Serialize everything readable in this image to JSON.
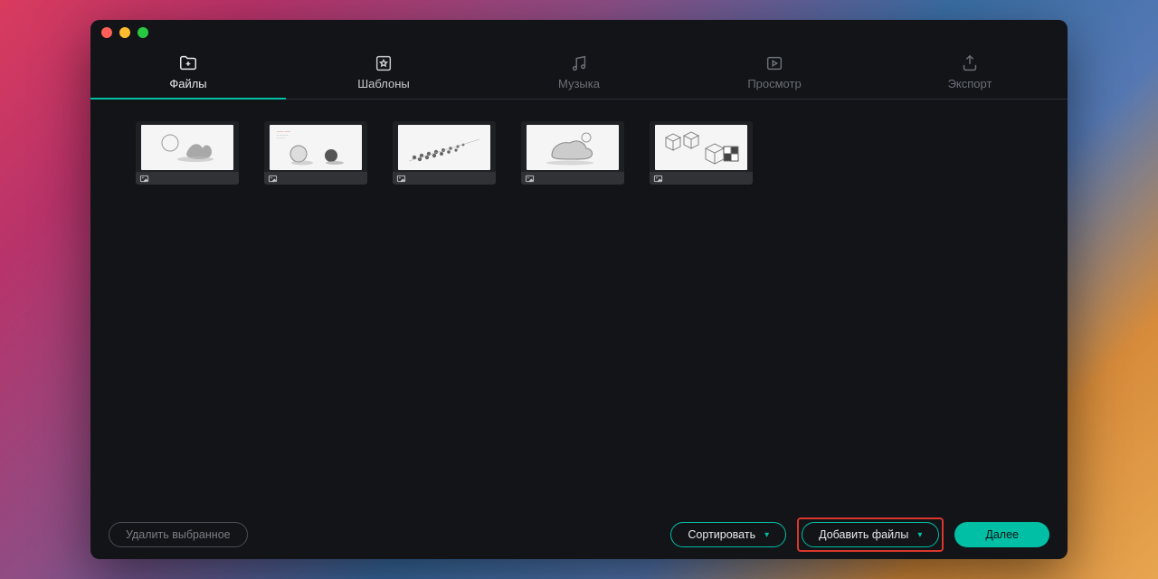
{
  "tabs": {
    "files": "Файлы",
    "templates": "Шаблоны",
    "music": "Музыка",
    "preview": "Просмотр",
    "export": "Экспорт"
  },
  "thumbnails": [
    {
      "kind": "image"
    },
    {
      "kind": "image"
    },
    {
      "kind": "image"
    },
    {
      "kind": "image"
    },
    {
      "kind": "image"
    }
  ],
  "footer": {
    "delete_selected": "Удалить выбранное",
    "sort": "Сортировать",
    "add_files": "Добавить файлы",
    "next": "Далее"
  },
  "colors": {
    "accent": "#00bfa5",
    "highlight": "#d9372c",
    "window_bg": "#121418"
  }
}
